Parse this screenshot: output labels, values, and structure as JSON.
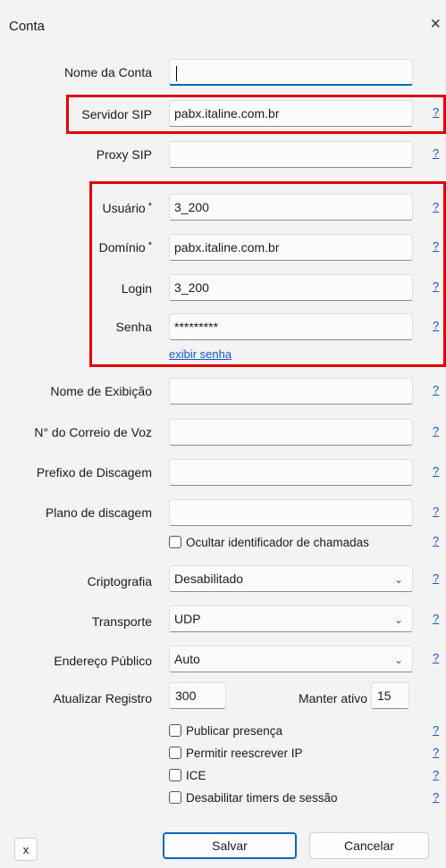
{
  "window": {
    "title": "Conta",
    "close_glyph": "×"
  },
  "labels": {
    "nome_conta": "Nome da Conta",
    "servidor_sip": "Servidor SIP",
    "proxy_sip": "Proxy SIP",
    "usuario": "Usuário",
    "dominio": "Domínio",
    "login": "Login",
    "senha": "Senha",
    "nome_exibicao": "Nome de Exibição",
    "correio_voz": "N° do Correio de Voz",
    "prefixo": "Prefixo de Discagem",
    "plano": "Plano de discagem",
    "criptografia": "Criptografia",
    "transporte": "Transporte",
    "endereco_publico": "Endereço Público",
    "atualizar_registro": "Atualizar Registro",
    "manter_ativo": "Manter ativo",
    "required_mark": "*"
  },
  "values": {
    "nome_conta": "",
    "servidor_sip": "pabx.italine.com.br",
    "proxy_sip": "",
    "usuario": "3_200",
    "dominio": "pabx.italine.com.br",
    "login": "3_200",
    "senha": "*********",
    "nome_exibicao": "",
    "correio_voz": "",
    "prefixo": "",
    "plano": "",
    "criptografia": "Desabilitado",
    "transporte": "UDP",
    "endereco_publico": "Auto",
    "atualizar_registro": "300",
    "manter_ativo": "15"
  },
  "links": {
    "exibir_senha": "exibir senha",
    "help": "?"
  },
  "checkboxes": {
    "ocultar": "Ocultar identificador de chamadas",
    "publicar": "Publicar presença",
    "reescrever": "Permitir reescrever IP",
    "ice": "ICE",
    "timers": "Desabilitar timers de sessão"
  },
  "buttons": {
    "x": "x",
    "salvar": "Salvar",
    "cancelar": "Cancelar"
  },
  "highlight_color": "#e00000",
  "accent_color": "#0067c0"
}
